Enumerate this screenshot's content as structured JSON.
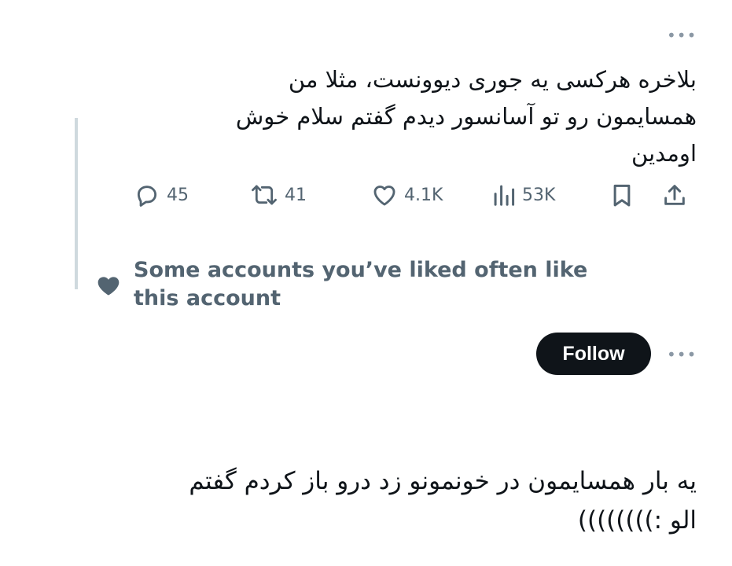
{
  "tweet": {
    "more_icon": "more-horizontal-icon",
    "lines": [
      "بلاخره هرکسی یه جوری دیوونست، مثلا من",
      "همسایمون رو تو آسانسور دیدم گفتم سلام خوش",
      "اومدین"
    ],
    "stats": {
      "replies": "45",
      "reposts": "41",
      "likes": "4.1K",
      "views": "53K"
    }
  },
  "recommendation": {
    "icon": "heart-icon",
    "line1": "Some accounts you’ve liked often like",
    "line2": "this account"
  },
  "follow": {
    "label": "Follow",
    "more_icon": "more-horizontal-icon"
  },
  "reply": {
    "lines": [
      "یه بار همسایمون در خونمونو زد درو باز کردم گفتم",
      "الو :))))))))"
    ]
  },
  "colors": {
    "text": "#0f1419",
    "secondary": "#536471",
    "icon_muted": "#8b98a5",
    "thread_line": "#cfd9de",
    "button": "#0f1419"
  }
}
